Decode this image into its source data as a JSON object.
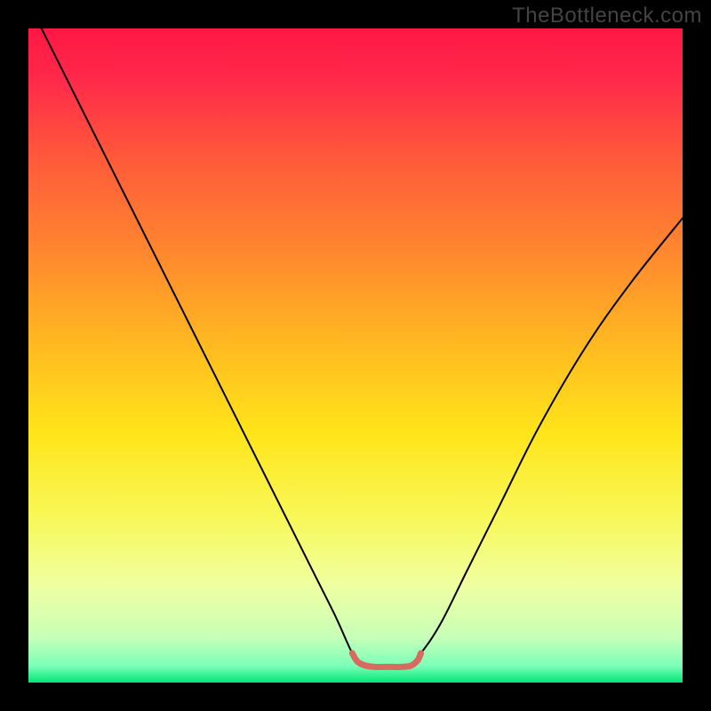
{
  "watermark": "TheBottleneck.com",
  "chart_data": {
    "type": "line",
    "title": "",
    "xlabel": "",
    "ylabel": "",
    "xlim": [
      0,
      100
    ],
    "ylim": [
      0,
      100
    ],
    "background_gradient": {
      "stops": [
        {
          "offset": 0.0,
          "color": "#ff1744"
        },
        {
          "offset": 0.08,
          "color": "#ff2a4a"
        },
        {
          "offset": 0.2,
          "color": "#ff5a3a"
        },
        {
          "offset": 0.35,
          "color": "#ff8a2e"
        },
        {
          "offset": 0.5,
          "color": "#ffbf1f"
        },
        {
          "offset": 0.62,
          "color": "#ffe51a"
        },
        {
          "offset": 0.75,
          "color": "#f8f85a"
        },
        {
          "offset": 0.85,
          "color": "#f0ffa0"
        },
        {
          "offset": 0.93,
          "color": "#c8ffb8"
        },
        {
          "offset": 0.975,
          "color": "#7affb8"
        },
        {
          "offset": 1.0,
          "color": "#00e676"
        }
      ]
    },
    "series": [
      {
        "name": "bottleneck-curve",
        "color": "#000000",
        "width": 2.0,
        "x": [
          0,
          2,
          5,
          8,
          12,
          16,
          20,
          24,
          28,
          32,
          36,
          40,
          44,
          47,
          49.5,
          51,
          55,
          58,
          60,
          63,
          67,
          72,
          78,
          85,
          92,
          100
        ],
        "y": [
          104,
          100,
          94,
          88,
          80,
          72,
          64,
          56,
          48,
          40,
          32,
          24,
          16,
          10,
          4.5,
          2.5,
          2.5,
          2.5,
          4.5,
          9,
          17,
          27,
          39,
          51,
          61,
          71
        ]
      },
      {
        "name": "sweet-spot-band",
        "color": "#d96a5f",
        "width": 7.0,
        "x": [
          49.5,
          50.3,
          51.5,
          53.0,
          55.0,
          57.0,
          58.5,
          59.5,
          60.0
        ],
        "y": [
          4.5,
          3.2,
          2.6,
          2.4,
          2.4,
          2.4,
          2.6,
          3.4,
          4.5
        ]
      }
    ]
  }
}
